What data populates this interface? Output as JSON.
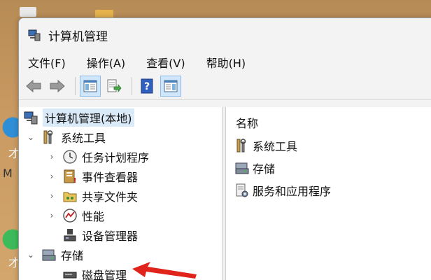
{
  "window": {
    "title": "计算机管理"
  },
  "menu": {
    "items": [
      "文件(F)",
      "操作(A)",
      "查看(V)",
      "帮助(H)"
    ]
  },
  "toolbar": {
    "buttons": [
      "back-icon",
      "forward-icon",
      "show-hide-tree-icon",
      "export-list-icon",
      "help-icon",
      "show-hide-action-pane-icon"
    ]
  },
  "tree": {
    "root": "计算机管理(本地)",
    "system_tools": "系统工具",
    "task_scheduler": "任务计划程序",
    "event_viewer": "事件查看器",
    "shared_folders": "共享文件夹",
    "performance": "性能",
    "device_manager": "设备管理器",
    "storage": "存储",
    "disk_management": "磁盘管理"
  },
  "list": {
    "column_header": "名称",
    "items": [
      "系统工具",
      "存储",
      "服务和应用程序"
    ]
  },
  "desktop": {
    "label_1": "才",
    "label_m": "M",
    "label_2": "才"
  },
  "colors": {
    "selection": "#dbeaf9",
    "annotation_arrow": "#e0241b"
  }
}
